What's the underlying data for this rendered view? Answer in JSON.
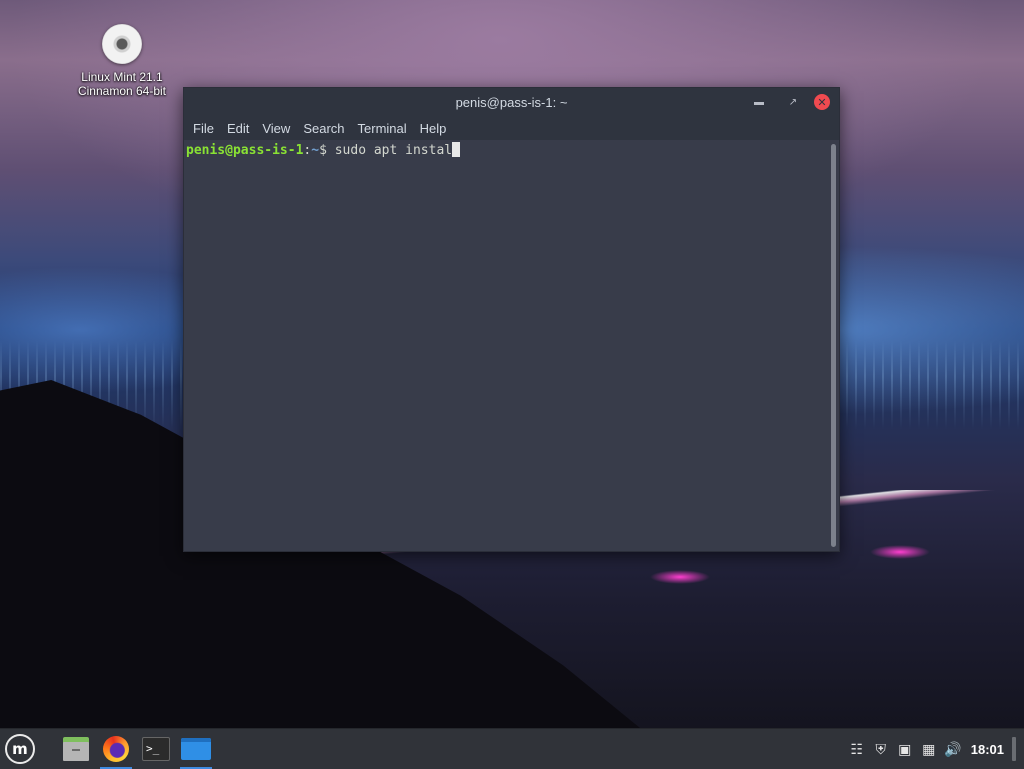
{
  "desktop": {
    "icons": [
      {
        "label_line1": "Linux Mint 21.1",
        "label_line2": "Cinnamon 64-bit",
        "icon": "disc-icon"
      }
    ]
  },
  "terminal_window": {
    "title": "penis@pass-is-1: ~",
    "controls": {
      "minimize": "minimize-icon",
      "maximize": "maximize-icon",
      "close": "close-icon"
    },
    "menu": [
      "File",
      "Edit",
      "View",
      "Search",
      "Terminal",
      "Help"
    ],
    "prompt": {
      "user_host": "penis@pass-is-1",
      "separator": ":",
      "directory": "~",
      "symbol": "$ ",
      "command": "sudo apt instal"
    },
    "colors": {
      "background": "#383c4a",
      "user_host": "#8ae234",
      "directory": "#729fcf"
    }
  },
  "panel": {
    "menu_button": "linux-mint-menu-icon",
    "launchers": [
      "file-manager-icon",
      "firefox-icon",
      "terminal-icon",
      "window-icon"
    ],
    "tray": [
      "update-manager-icon",
      "shield-icon",
      "user-icon",
      "network-icon",
      "volume-icon"
    ],
    "clock": "18:01"
  }
}
